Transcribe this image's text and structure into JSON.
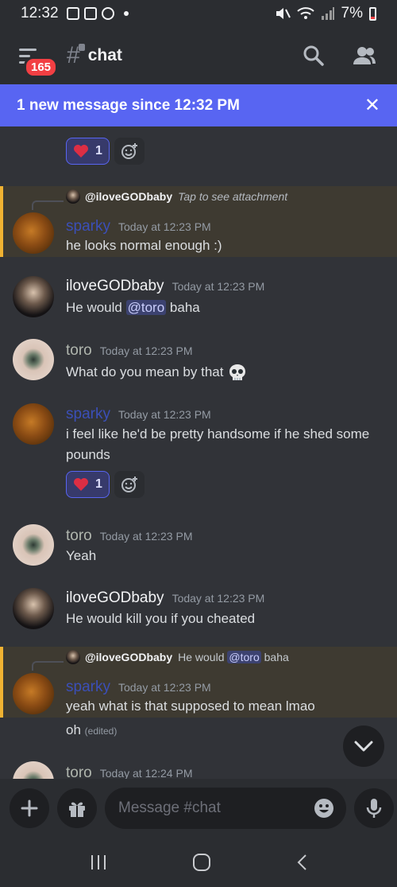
{
  "status_bar": {
    "time": "12:32",
    "battery": "7%"
  },
  "header": {
    "badge": "165",
    "channel": "chat"
  },
  "banner": {
    "text": "1 new message since 12:32 PM"
  },
  "messages": [
    {
      "author": "iloveGODbaby",
      "time": "Today at 12:23 PM",
      "text": "He would",
      "mention": "@toro",
      "text_after": "baha"
    },
    {
      "author": "toro",
      "time": "Today at 12:23 PM",
      "text": "What do you mean by that"
    },
    {
      "author": "sparky",
      "time": "Today at 12:23 PM",
      "text": "i feel like he'd be pretty handsome if he shed some pounds"
    },
    {
      "author": "toro",
      "time": "Today at 12:23 PM",
      "text": "Yeah"
    },
    {
      "author": "iloveGODbaby",
      "time": "Today at 12:23 PM",
      "text": "He would kill you if you cheated"
    },
    {
      "author": "sparky",
      "time": "Today at 12:23 PM",
      "text": "yeah what is that supposed to mean lmao",
      "followup": "oh",
      "edited": "(edited)"
    },
    {
      "author": "toro",
      "time": "Today at 12:24 PM"
    }
  ],
  "reply_1": {
    "author": "sparky",
    "time": "Today at 12:23 PM",
    "text": "he looks normal enough :)",
    "reply_to": "@iloveGODbaby",
    "reply_hint": "Tap to see attachment"
  },
  "reply_2": {
    "reply_to": "@iloveGODbaby",
    "reply_text": "He would",
    "reply_mention": "@toro",
    "reply_after": "baha"
  },
  "reactions": {
    "top_count": "1",
    "mid_count": "1"
  },
  "composer": {
    "placeholder": "Message #chat"
  },
  "colors": {
    "background": "#313338",
    "accent": "#5865f2",
    "highlight_bar": "#f0b232",
    "badge": "#f23f43"
  },
  "icons": [
    "menu-icon",
    "channel-hash-lock-icon",
    "search-icon",
    "members-icon",
    "close-icon",
    "heart-icon",
    "add-reaction-icon",
    "skull-emoji-icon",
    "chevron-down-icon",
    "plus-icon",
    "gift-icon",
    "emoji-icon",
    "microphone-icon",
    "recent-apps-icon",
    "home-icon",
    "back-icon"
  ]
}
